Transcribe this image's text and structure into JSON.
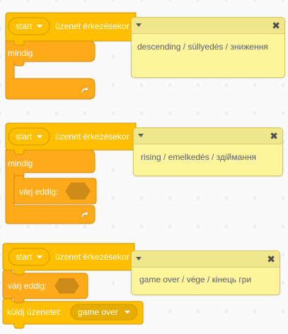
{
  "scripts": [
    {
      "hat": {
        "dropdown_value": "start",
        "label": "üzenet érkezésekor"
      },
      "forever_label": "mindig",
      "comment": "descending / süllyedés / зниження"
    },
    {
      "hat": {
        "dropdown_value": "start",
        "label": "üzenet érkezésekor"
      },
      "forever_label": "mindig",
      "wait_until_label": "várj eddig:",
      "comment": "rising / emelkedés / здіймання"
    },
    {
      "hat": {
        "dropdown_value": "start",
        "label": "üzenet érkezésekor"
      },
      "wait_until_label": "várj eddig:",
      "broadcast": {
        "label": "küldj üzenetet:",
        "dropdown_value": "game over"
      },
      "comment": "game over / vége / кінець гри"
    }
  ],
  "icons": {
    "repeat_arrow": "loop-arrow-icon",
    "dropdown_caret": "caret-down-icon",
    "comment_collapse": "caret-down-icon",
    "comment_close": "close-icon"
  },
  "comment_close_glyph": "✖",
  "colors": {
    "events_block": "#ffbf00",
    "events_border": "#cc9900",
    "control_block": "#ffab19",
    "control_border": "#cf8b17",
    "comment_bg": "#fef49c",
    "comment_bar": "#f0e68c"
  }
}
